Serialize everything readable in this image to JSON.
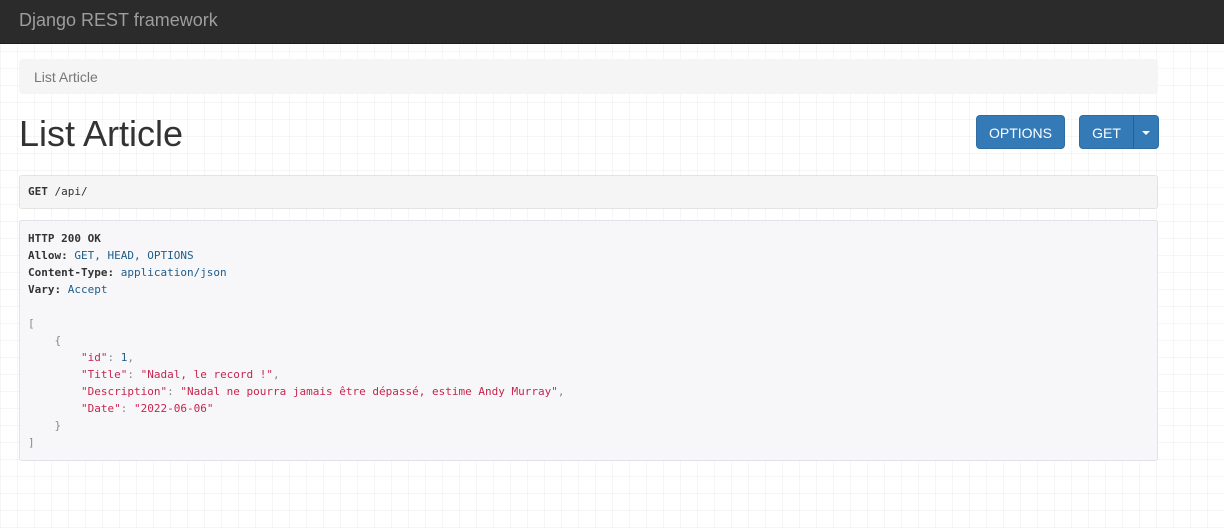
{
  "navbar": {
    "brand": "Django REST framework"
  },
  "breadcrumb": {
    "current": "List Article"
  },
  "page": {
    "title": "List Article"
  },
  "buttons": {
    "options": "OPTIONS",
    "get": "GET"
  },
  "request": {
    "method": "GET",
    "path": "/api/"
  },
  "response": {
    "status": "HTTP 200 OK",
    "headers": [
      {
        "name": "Allow:",
        "value": "GET, HEAD, OPTIONS"
      },
      {
        "name": "Content-Type:",
        "value": "application/json"
      },
      {
        "name": "Vary:",
        "value": "Accept"
      }
    ],
    "body": {
      "open_bracket": "[",
      "open_brace": "{",
      "fields": [
        {
          "key": "\"id\"",
          "value": "1",
          "type": "number",
          "comma": ","
        },
        {
          "key": "\"Title\"",
          "value": "\"Nadal, le record !\"",
          "type": "string",
          "comma": ","
        },
        {
          "key": "\"Description\"",
          "value": "\"Nadal ne pourra jamais être dépassé, estime Andy Murray\"",
          "type": "string",
          "comma": ","
        },
        {
          "key": "\"Date\"",
          "value": "\"2022-06-06\"",
          "type": "string",
          "comma": ""
        }
      ],
      "close_brace": "}",
      "close_bracket": "]"
    }
  },
  "colors": {
    "navbar_bg": "#2b2b2b",
    "primary_button": "#337ab7",
    "json_string": "#c7254e",
    "json_literal": "#1f5c8a"
  }
}
